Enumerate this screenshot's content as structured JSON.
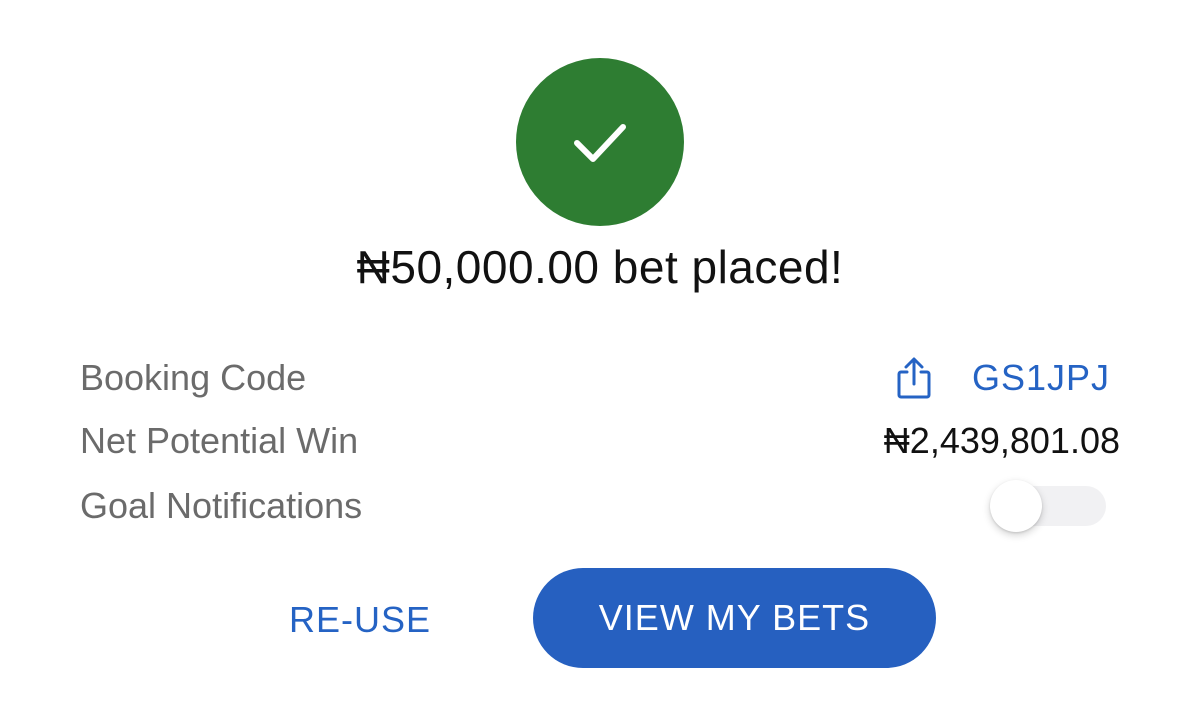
{
  "confirmation": {
    "headline": "₦50,000.00 bet placed!",
    "icon": "checkmark-icon",
    "success_color": "#2e7d32"
  },
  "details": {
    "booking_code_label": "Booking Code",
    "booking_code_value": "GS1JPJ",
    "share_icon": "share-icon",
    "net_potential_win_label": "Net Potential Win",
    "net_potential_win_value": "₦2,439,801.08",
    "goal_notifications_label": "Goal Notifications",
    "goal_notifications_enabled": false
  },
  "actions": {
    "reuse_label": "RE-USE",
    "view_my_bets_label": "VIEW MY BETS",
    "accent_color": "#2660c0"
  }
}
